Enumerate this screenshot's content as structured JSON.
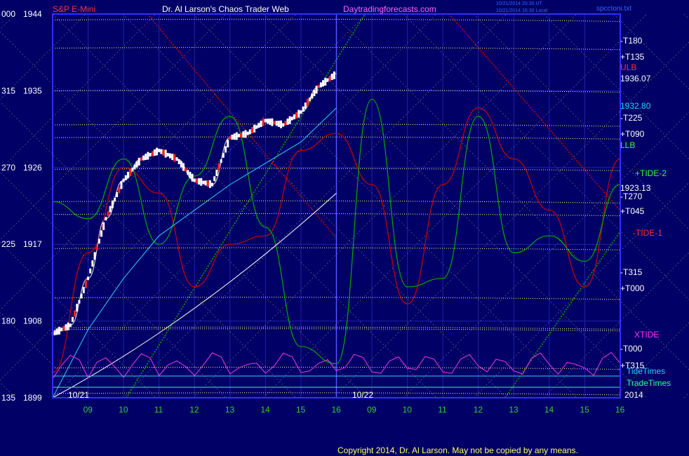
{
  "header": {
    "left_title": "S&P E-Mini",
    "center_title": "Dr. Al Larson's Chaos Trader Web",
    "site": "Daytradingforecasts.com",
    "stamp_line1": "10/21/2014 20:30 UT",
    "stamp_line2": "10/21/2014 16:30 Local",
    "file": "spcctoni.txt"
  },
  "footer": {
    "copyright": "Copyright 2014, Dr. Al Larson. May not be copied by any means."
  },
  "colors": {
    "background": "#000066",
    "frame": "#3030ff",
    "price_bar": "#ffffff",
    "tide1": "#cc0000",
    "tide2": "#00aa00",
    "xtide": "#cc33cc",
    "level": "#ffff66",
    "ma_cyan": "#33ccff"
  },
  "chart_data": {
    "type": "line",
    "title": "S&P E-Mini",
    "y_axis": {
      "ticks": [
        {
          "left": "000",
          "price": "1944"
        },
        {
          "left": "315",
          "price": "1935"
        },
        {
          "left": "270",
          "price": "1926"
        },
        {
          "left": "225",
          "price": "1917"
        },
        {
          "left": "180",
          "price": "1908"
        },
        {
          "left": "135",
          "price": "1899"
        }
      ],
      "ylim": [
        1899,
        1944
      ]
    },
    "x_axis": {
      "ticks": [
        "09",
        "10",
        "11",
        "12",
        "13",
        "14",
        "15",
        "16",
        "09",
        "10",
        "11",
        "12",
        "13",
        "14",
        "15",
        "16"
      ],
      "date_labels": [
        "10/21",
        "10/22"
      ],
      "year": "2014"
    },
    "right_labels": [
      {
        "text": "-T180",
        "color": "#ffffff"
      },
      {
        "text": "+T135",
        "color": "#ffffff"
      },
      {
        "text": "ULB",
        "color": "#ff3333"
      },
      {
        "text": "1936.07",
        "color": "#ffffff"
      },
      {
        "text": "1932.80",
        "color": "#33ccff"
      },
      {
        "text": "-T225",
        "color": "#ffffff"
      },
      {
        "text": "+T090",
        "color": "#ffffff"
      },
      {
        "text": "LLB",
        "color": "#33ff33"
      },
      {
        "text": "+TIDE-2",
        "color": "#33ff33"
      },
      {
        "text": "1923.13",
        "color": "#ffffff"
      },
      {
        "text": "-T270",
        "color": "#ffffff"
      },
      {
        "text": "+T045",
        "color": "#ffffff"
      },
      {
        "text": "-TIDE-1",
        "color": "#ff3333"
      },
      {
        "text": "-T315",
        "color": "#ffffff"
      },
      {
        "text": "+T000",
        "color": "#ffffff"
      },
      {
        "text": "XTIDE",
        "color": "#ff33ff"
      },
      {
        "text": "-T000",
        "color": "#ffffff"
      },
      {
        "text": "+T315",
        "color": "#ffffff"
      },
      {
        "text": "TideTimes",
        "color": "#33ccff"
      },
      {
        "text": "TradeTimes",
        "color": "#33ff99"
      }
    ],
    "series": [
      {
        "name": "S&P E-Mini",
        "x": [
          0,
          0.5,
          1,
          1.5,
          2,
          2.5,
          3,
          3.5,
          4,
          4.5,
          5,
          5.5,
          6,
          6.5,
          7,
          7.5,
          8
        ],
        "values": [
          1906.5,
          1907.5,
          1913,
          1920,
          1924.5,
          1927,
          1928,
          1927,
          1924.5,
          1924,
          1929.5,
          1930,
          1931.5,
          1931,
          1932.5,
          1935.5,
          1937
        ]
      },
      {
        "name": "TIDE-1",
        "x": [
          0,
          1,
          2,
          3,
          4,
          5,
          6,
          7,
          8,
          9,
          10,
          11,
          12,
          13,
          14,
          15,
          16
        ],
        "values": [
          1902,
          1916,
          1926,
          1923,
          1912,
          1917,
          1918,
          1928,
          1930,
          1924,
          1910,
          1924,
          1933,
          1927,
          1921,
          1912,
          1927
        ]
      },
      {
        "name": "TIDE-2",
        "x": [
          0,
          1,
          2,
          3,
          4,
          5,
          6,
          7,
          8,
          9,
          10,
          11,
          12,
          13,
          14,
          15,
          16
        ],
        "values": [
          1922,
          1920,
          1927,
          1917,
          1925,
          1932,
          1919,
          1905,
          1903,
          1934,
          1912,
          1913,
          1932,
          1916,
          1918,
          1915,
          1924
        ]
      }
    ]
  }
}
